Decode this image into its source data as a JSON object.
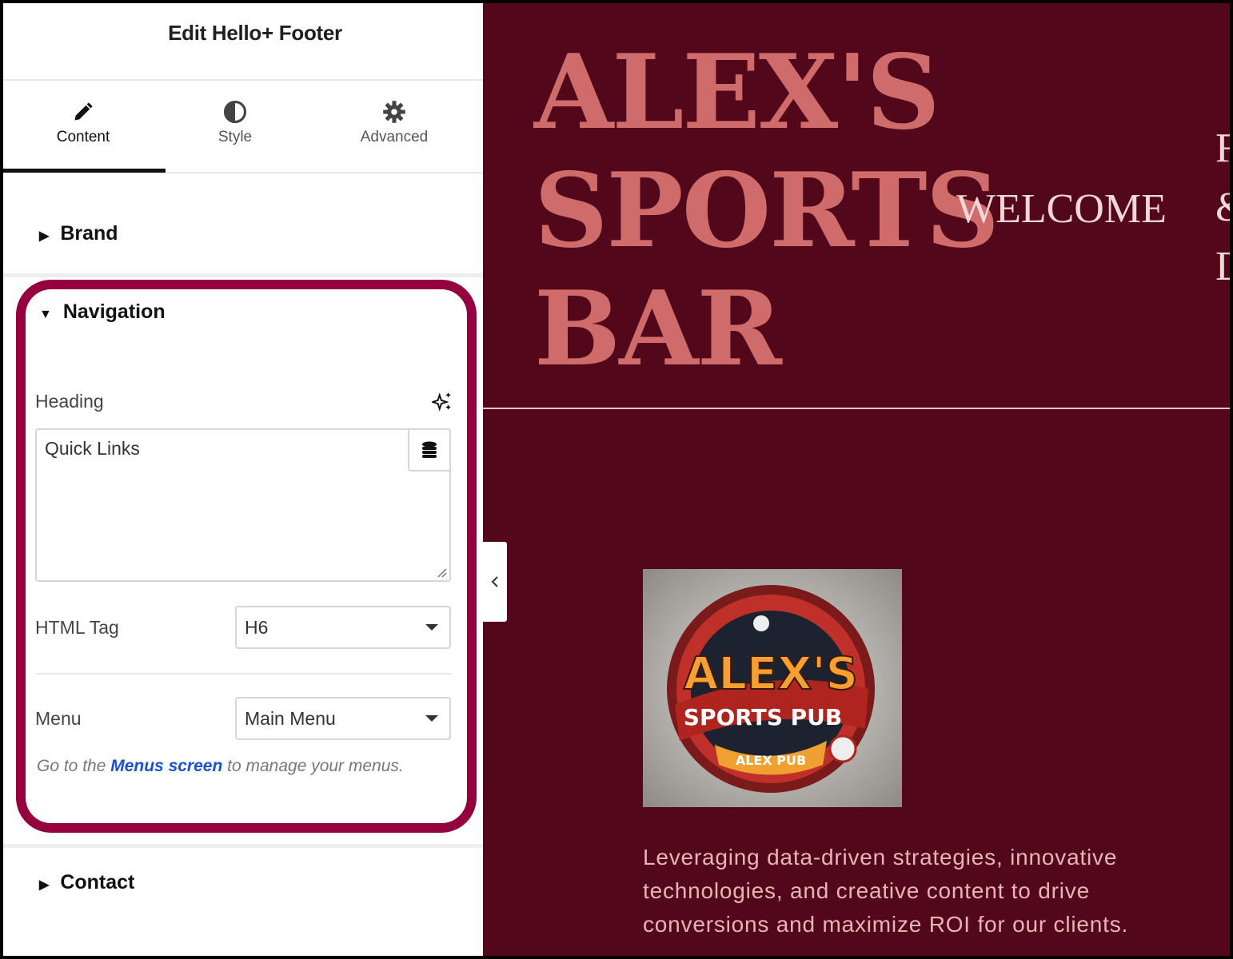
{
  "panel": {
    "title": "Edit Hello+ Footer",
    "tabs": [
      {
        "label": "Content",
        "icon": "pencil-icon",
        "active": true
      },
      {
        "label": "Style",
        "icon": "half-circle-icon"
      },
      {
        "label": "Advanced",
        "icon": "gear-icon"
      }
    ],
    "sections": {
      "brand": "Brand",
      "navigation": "Navigation",
      "contact": "Contact"
    },
    "navigation": {
      "heading_label": "Heading",
      "heading_value": "Quick Links",
      "html_tag_label": "HTML Tag",
      "html_tag_value": "H6",
      "menu_label": "Menu",
      "menu_value": "Main Menu",
      "note_prefix": "Go to the ",
      "note_link": "Menus screen",
      "note_suffix": " to manage your menus."
    },
    "highlight_color": "#95003e"
  },
  "preview": {
    "title_lines": [
      "ALEX'S",
      "SPORTS",
      "BAR"
    ],
    "welcome": "WELCOME",
    "edge_letters": [
      "F",
      "&",
      "D"
    ],
    "logo_text": [
      "ALEX'S",
      "SPORTS PUB",
      "ALEX PUB"
    ],
    "description": "Leveraging data-driven strategies, innovative technologies, and creative content to drive conversions and maximize ROI for our clients.",
    "background": "#52071a",
    "accent": "#cf6b6b"
  }
}
